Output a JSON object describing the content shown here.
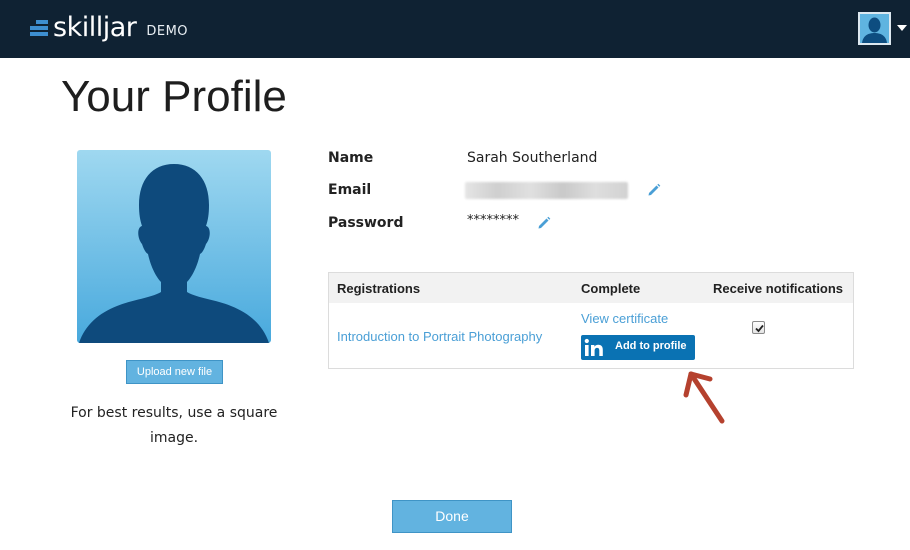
{
  "header": {
    "brand": "skilljar",
    "brand_suffix": "DEMO"
  },
  "page": {
    "title": "Your Profile"
  },
  "profile_photo": {
    "upload_label": "Upload new file",
    "hint": "For best results, use a square image."
  },
  "fields": {
    "name_label": "Name",
    "name_value": "Sarah Southerland",
    "email_label": "Email",
    "password_label": "Password",
    "password_value": "********"
  },
  "registrations": {
    "headers": {
      "course": "Registrations",
      "complete": "Complete",
      "notifications": "Receive notifications"
    },
    "rows": [
      {
        "course": "Introduction to Portrait Photography",
        "certificate_link": "View certificate",
        "linkedin_label": "Add to profile",
        "notifications_checked": true
      }
    ]
  },
  "actions": {
    "done_label": "Done"
  },
  "colors": {
    "header_bg": "#0f2233",
    "button_blue": "#62b3e0",
    "link_blue": "#4a9fd6",
    "linkedin_blue": "#0a72b3",
    "annotation_arrow": "#b5412e"
  },
  "icons": {
    "edit": "pencil-icon",
    "linkedin": "linkedin-icon",
    "avatar": "user-silhouette-icon"
  }
}
